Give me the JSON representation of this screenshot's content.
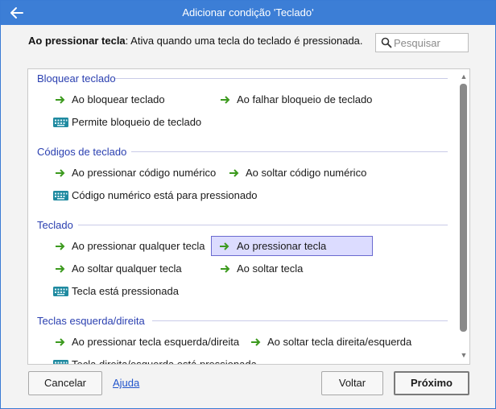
{
  "window": {
    "title": "Adicionar condição 'Teclado'"
  },
  "description": {
    "bold": "Ao pressionar tecla",
    "rest": ": Ativa quando uma tecla do teclado é pressionada."
  },
  "search": {
    "placeholder": "Pesquisar",
    "value": ""
  },
  "groups": [
    {
      "title": "Bloquear teclado",
      "items": [
        {
          "label": "Ao bloquear teclado",
          "icon": "green-arrow-icon"
        },
        {
          "label": "Ao falhar bloqueio de teclado",
          "icon": "green-arrow-icon"
        },
        {
          "label": "Permite bloqueio de teclado",
          "icon": "keyboard-icon"
        }
      ]
    },
    {
      "title": "Códigos de teclado",
      "items": [
        {
          "label": "Ao pressionar código numérico",
          "icon": "green-arrow-icon"
        },
        {
          "label": "Ao soltar código numérico",
          "icon": "green-arrow-icon"
        },
        {
          "label": "Código numérico está para pressionado",
          "icon": "keyboard-icon"
        }
      ]
    },
    {
      "title": "Teclado",
      "items": [
        {
          "label": "Ao pressionar qualquer tecla",
          "icon": "green-arrow-icon"
        },
        {
          "label": "Ao pressionar tecla",
          "icon": "green-arrow-icon",
          "selected": true
        },
        {
          "label": "Ao soltar qualquer tecla",
          "icon": "green-arrow-icon"
        },
        {
          "label": "Ao soltar tecla",
          "icon": "green-arrow-icon"
        },
        {
          "label": "Tecla está pressionada",
          "icon": "keyboard-icon"
        }
      ]
    },
    {
      "title": "Teclas esquerda/direita",
      "items": [
        {
          "label": "Ao pressionar tecla esquerda/direita",
          "icon": "green-arrow-icon"
        },
        {
          "label": "Ao soltar tecla direita/esquerda",
          "icon": "green-arrow-icon"
        },
        {
          "label": "Tecla direita/esquerda está pressionada",
          "icon": "keyboard-icon"
        }
      ]
    }
  ],
  "buttons": {
    "cancel": "Cancelar",
    "help": "Ajuda",
    "back": "Voltar",
    "next": "Próximo"
  },
  "colors": {
    "titlebar": "#3c7ed6",
    "group_heading": "#2a3fb0",
    "arrow": "#3c9a1e",
    "keyboard": "#1f8aa0",
    "selected_bg": "#dcdcff"
  }
}
